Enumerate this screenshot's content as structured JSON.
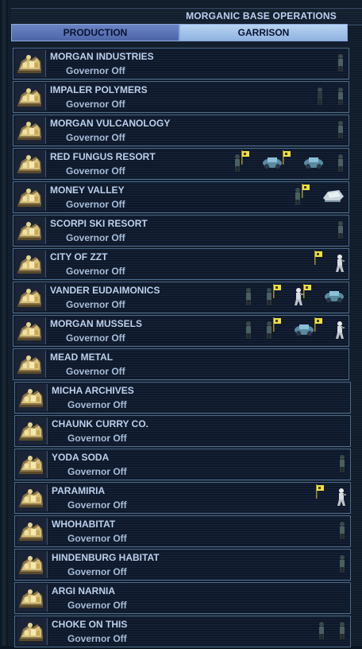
{
  "header": {
    "title": "MORGANIC BASE OPERATIONS"
  },
  "tabs": [
    {
      "label": "PRODUCTION"
    },
    {
      "label": "GARRISON"
    }
  ],
  "bases": [
    {
      "name": "MORGAN INDUSTRIES",
      "governor": "Governor Off",
      "units": [
        "soldier"
      ]
    },
    {
      "name": "IMPALER POLYMERS",
      "governor": "Governor Off",
      "units": [
        "soldier-dark",
        "soldier"
      ]
    },
    {
      "name": "MORGAN VULCANOLOGY",
      "governor": "Governor Off",
      "units": [
        "soldier"
      ]
    },
    {
      "name": "RED FUNGUS RESORT",
      "governor": "Governor Off",
      "units": [
        "soldier",
        "flag",
        "rover",
        "flag",
        "rover",
        "soldier"
      ]
    },
    {
      "name": "MONEY VALLEY",
      "governor": "Governor Off",
      "units": [
        "soldier",
        "flag",
        "hovertank"
      ]
    },
    {
      "name": "SCORPI SKI RESORT",
      "governor": "Governor Off",
      "units": [
        "soldier"
      ]
    },
    {
      "name": "CITY OF ZZT",
      "governor": "Governor Off",
      "units": [
        "flag",
        "trooper"
      ]
    },
    {
      "name": "VANDER EUDAIMONICS",
      "governor": "Governor Off",
      "units": [
        "soldier",
        "soldier",
        "flag",
        "trooper",
        "flag",
        "rover"
      ]
    },
    {
      "name": "MORGAN MUSSELS",
      "governor": "Governor Off",
      "units": [
        "soldier",
        "soldier",
        "flag",
        "rover",
        "flag",
        "trooper"
      ]
    },
    {
      "name": "MEAD METAL",
      "governor": "Governor Off",
      "units": []
    },
    {
      "name": "MICHA ARCHIVES",
      "governor": "Governor Off",
      "units": []
    },
    {
      "name": "CHAUNK CURRY CO.",
      "governor": "Governor Off",
      "units": []
    },
    {
      "name": "YODA SODA",
      "governor": "Governor Off",
      "units": [
        "soldier"
      ]
    },
    {
      "name": "PARAMIRIA",
      "governor": "Governor Off",
      "units": [
        "flag",
        "trooper"
      ]
    },
    {
      "name": "WHOHABITAT",
      "governor": "Governor Off",
      "units": [
        "soldier"
      ]
    },
    {
      "name": "HINDENBURG HABITAT",
      "governor": "Governor Off",
      "units": [
        "soldier"
      ]
    },
    {
      "name": "ARGI NARNIA",
      "governor": "Governor Off",
      "units": []
    },
    {
      "name": "CHOKE ON THIS",
      "governor": "Governor Off",
      "units": [
        "soldier",
        "soldier"
      ]
    }
  ]
}
